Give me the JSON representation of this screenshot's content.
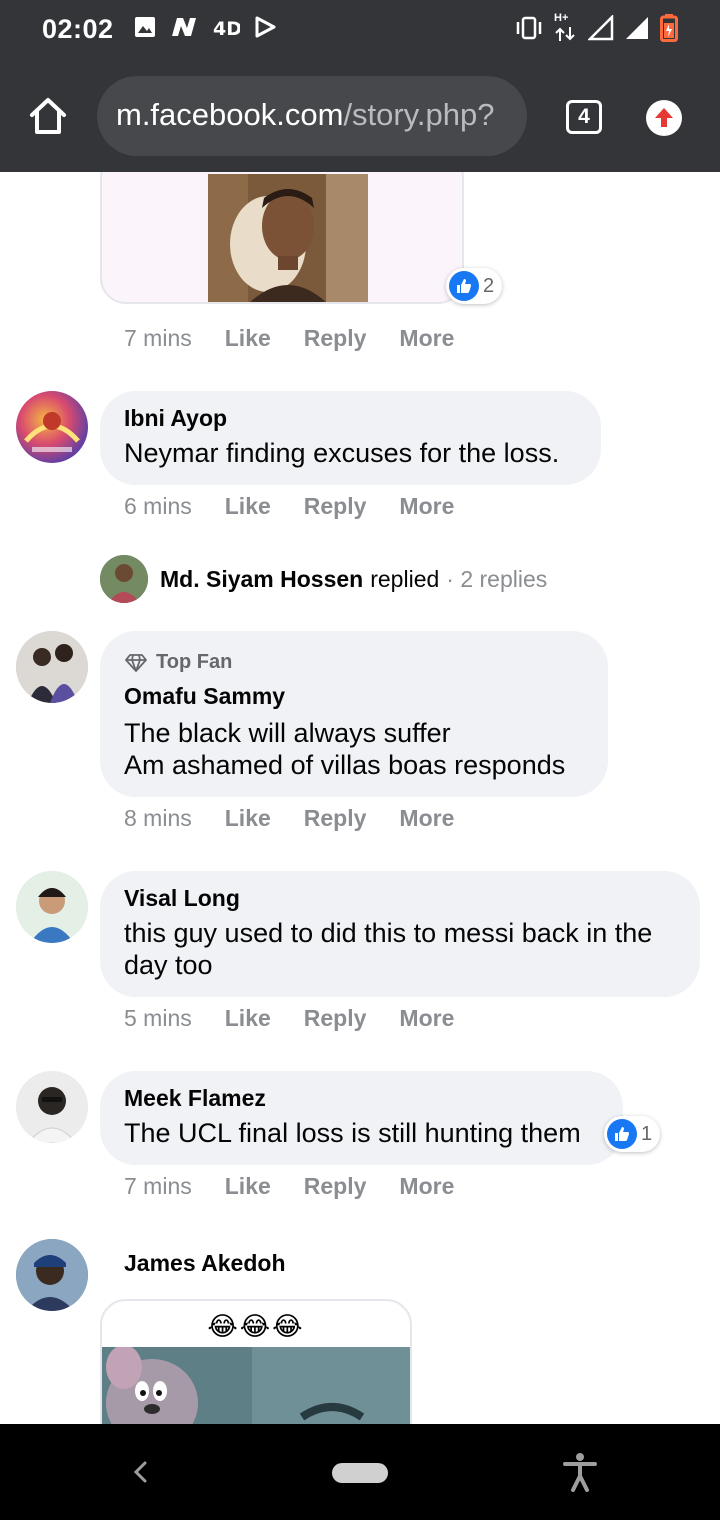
{
  "status_bar": {
    "time": "02:02",
    "left_icons": [
      "image-icon",
      "n-app-icon",
      "4d-app-icon",
      "play-store-icon"
    ],
    "right_icons": [
      "vibrate-icon",
      "hplus-data-icon",
      "signal-icon",
      "signal-icon",
      "battery-icon"
    ],
    "network_label": "H+"
  },
  "browser": {
    "url_host": "m.facebook.com",
    "url_path": "/story.php?",
    "tab_count": "4"
  },
  "comments": [
    {
      "id": "c0",
      "time": "7 mins",
      "reactions": "2",
      "actions": [
        "Like",
        "Reply",
        "More"
      ]
    },
    {
      "id": "c1",
      "author": "Ibni Ayop",
      "text": "Neymar finding excuses for the loss.",
      "time": "6 mins",
      "actions": [
        "Like",
        "Reply",
        "More"
      ]
    },
    {
      "id": "replies",
      "author": "Md. Siyam Hossen",
      "verb": "replied",
      "count": "· 2 replies"
    },
    {
      "id": "c2",
      "badge": "Top Fan",
      "author": "Omafu Sammy",
      "text_line1": "The black will always suffer",
      "text_line2": "Am ashamed of villas boas responds",
      "time": "8 mins",
      "actions": [
        "Like",
        "Reply",
        "More"
      ]
    },
    {
      "id": "c3",
      "author": "Visal Long",
      "text_line1": "this guy used to did this to messi back in the",
      "text_line2": "day too",
      "time": "5 mins",
      "actions": [
        "Like",
        "Reply",
        "More"
      ]
    },
    {
      "id": "c4",
      "author": "Meek Flamez",
      "text": "The UCL final loss is still hunting them",
      "reactions": "1",
      "time": "7 mins",
      "actions": [
        "Like",
        "Reply",
        "More"
      ]
    },
    {
      "id": "c5",
      "author": "James Akedoh",
      "emoji_caption": "😂😂😂"
    }
  ],
  "colors": {
    "bar_bg": "#333538",
    "url_bg": "#46484b",
    "bubble_bg": "#f0f2f5",
    "like_blue": "#1877f2",
    "muted_text": "#8a8d91"
  }
}
